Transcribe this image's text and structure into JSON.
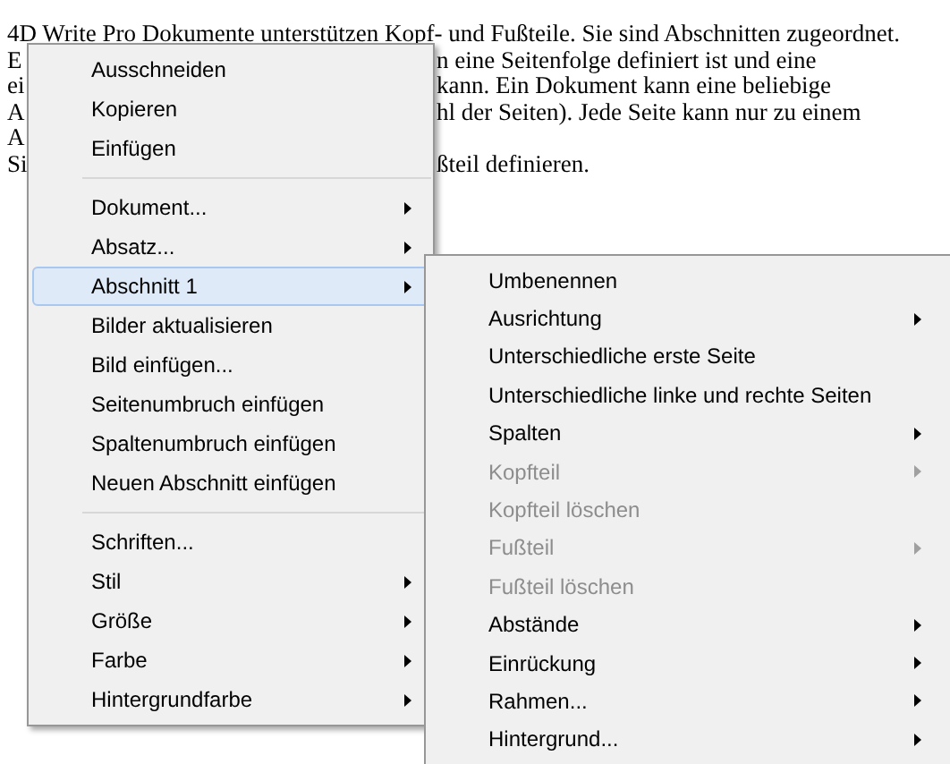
{
  "document": {
    "lines": [
      {
        "left": "4D Write Pro Dokumente unterstützen Kopf- und Fußteile. Sie sind Abschnitten zugeordnet."
      },
      {
        "left": "E",
        "right": "n eine Seitenfolge definiert ist und eine"
      },
      {
        "left": "ei",
        "right": "kann. Ein Dokument kann eine beliebige"
      },
      {
        "left": "A",
        "right": "hl der Seiten). Jede Seite kann nur zu einem"
      },
      {
        "left": "A"
      },
      {
        "left": "Si",
        "right": "ßteil definieren."
      }
    ]
  },
  "context_menu": {
    "items": [
      {
        "kind": "item",
        "label": "Ausschneiden",
        "submenu": false,
        "disabled": false,
        "selected": false
      },
      {
        "kind": "item",
        "label": "Kopieren",
        "submenu": false,
        "disabled": false,
        "selected": false
      },
      {
        "kind": "item",
        "label": "Einfügen",
        "submenu": false,
        "disabled": false,
        "selected": false
      },
      {
        "kind": "separator"
      },
      {
        "kind": "item",
        "label": "Dokument...",
        "submenu": true,
        "disabled": false,
        "selected": false
      },
      {
        "kind": "item",
        "label": "Absatz...",
        "submenu": true,
        "disabled": false,
        "selected": false
      },
      {
        "kind": "item",
        "label": "Abschnitt 1",
        "submenu": true,
        "disabled": false,
        "selected": true
      },
      {
        "kind": "item",
        "label": "Bilder aktualisieren",
        "submenu": false,
        "disabled": false,
        "selected": false
      },
      {
        "kind": "item",
        "label": "Bild einfügen...",
        "submenu": false,
        "disabled": false,
        "selected": false
      },
      {
        "kind": "item",
        "label": "Seitenumbruch einfügen",
        "submenu": false,
        "disabled": false,
        "selected": false
      },
      {
        "kind": "item",
        "label": "Spaltenumbruch einfügen",
        "submenu": false,
        "disabled": false,
        "selected": false
      },
      {
        "kind": "item",
        "label": "Neuen Abschnitt einfügen",
        "submenu": false,
        "disabled": false,
        "selected": false
      },
      {
        "kind": "separator"
      },
      {
        "kind": "item",
        "label": "Schriften...",
        "submenu": false,
        "disabled": false,
        "selected": false
      },
      {
        "kind": "item",
        "label": "Stil",
        "submenu": true,
        "disabled": false,
        "selected": false
      },
      {
        "kind": "item",
        "label": "Größe",
        "submenu": true,
        "disabled": false,
        "selected": false
      },
      {
        "kind": "item",
        "label": "Farbe",
        "submenu": true,
        "disabled": false,
        "selected": false
      },
      {
        "kind": "item",
        "label": "Hintergrundfarbe",
        "submenu": true,
        "disabled": false,
        "selected": false
      }
    ]
  },
  "submenu": {
    "items": [
      {
        "kind": "item",
        "label": "Umbenennen",
        "submenu": false,
        "disabled": false,
        "selected": false
      },
      {
        "kind": "item",
        "label": "Ausrichtung",
        "submenu": true,
        "disabled": false,
        "selected": false
      },
      {
        "kind": "item",
        "label": "Unterschiedliche erste Seite",
        "submenu": false,
        "disabled": false,
        "selected": false
      },
      {
        "kind": "item",
        "label": "Unterschiedliche linke und rechte Seiten",
        "submenu": false,
        "disabled": false,
        "selected": false
      },
      {
        "kind": "item",
        "label": "Spalten",
        "submenu": true,
        "disabled": false,
        "selected": false
      },
      {
        "kind": "item",
        "label": "Kopfteil",
        "submenu": true,
        "disabled": true,
        "selected": false
      },
      {
        "kind": "item",
        "label": "Kopfteil löschen",
        "submenu": false,
        "disabled": true,
        "selected": false
      },
      {
        "kind": "item",
        "label": "Fußteil",
        "submenu": true,
        "disabled": true,
        "selected": false
      },
      {
        "kind": "item",
        "label": "Fußteil löschen",
        "submenu": false,
        "disabled": true,
        "selected": false
      },
      {
        "kind": "item",
        "label": "Abstände",
        "submenu": true,
        "disabled": false,
        "selected": false
      },
      {
        "kind": "item",
        "label": "Einrückung",
        "submenu": true,
        "disabled": false,
        "selected": false
      },
      {
        "kind": "item",
        "label": "Rahmen...",
        "submenu": true,
        "disabled": false,
        "selected": false
      },
      {
        "kind": "item",
        "label": "Hintergrund...",
        "submenu": true,
        "disabled": false,
        "selected": false
      }
    ]
  }
}
